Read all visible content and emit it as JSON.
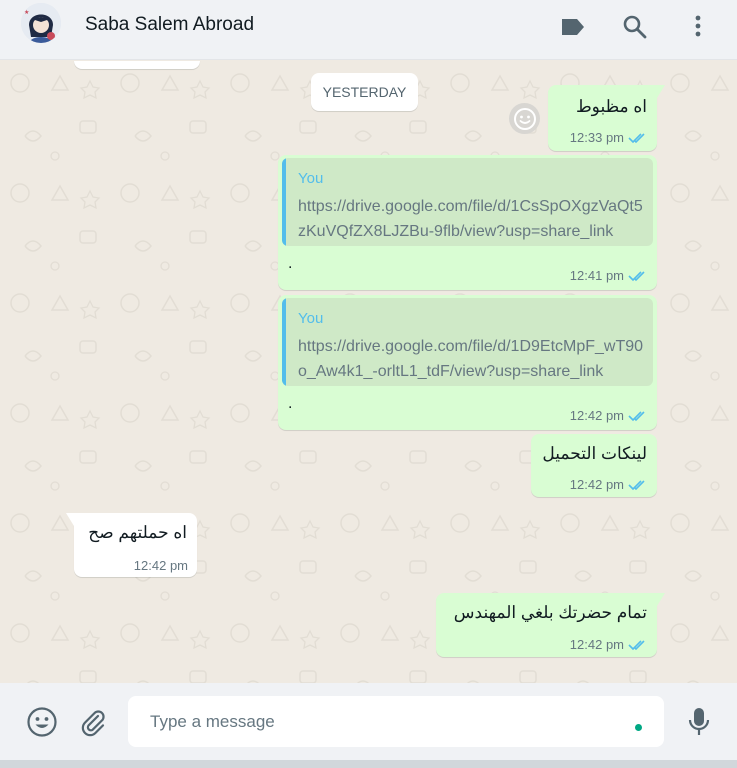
{
  "header": {
    "contact_name": "Saba Salem Abroad",
    "icons": [
      "label-icon",
      "search-icon",
      "menu-icon"
    ]
  },
  "chat": {
    "date_chip": "YESTERDAY",
    "messages": [
      {
        "direction": "out",
        "text": "اه مظبوط",
        "time": "12:33 pm",
        "status": "read"
      },
      {
        "direction": "out",
        "quote_author": "You",
        "quote_text": "https://drive.google.com/file/d/1CsSpOXgzVaQt5zKuVQfZX8LJZBu-9flb/view?usp=share_link",
        "text": ".",
        "time": "12:41 pm",
        "status": "read"
      },
      {
        "direction": "out",
        "quote_author": "You",
        "quote_text": "https://drive.google.com/file/d/1D9EtcMpF_wT90o_Aw4k1_-orltL1_tdF/view?usp=share_link",
        "text": ".",
        "time": "12:42 pm",
        "status": "read"
      },
      {
        "direction": "out",
        "text": "لينكات التحميل",
        "time": "12:42 pm",
        "status": "read"
      },
      {
        "direction": "in",
        "text": "اه حملتهم صح",
        "time": "12:42 pm"
      },
      {
        "direction": "out",
        "text": "تمام حضرتك بلغي المهندس",
        "time": "12:42 pm",
        "status": "read"
      }
    ]
  },
  "footer": {
    "placeholder": "Type a message",
    "icons": [
      "emoji-icon",
      "attach-icon",
      "mic-icon"
    ]
  },
  "colors": {
    "outgoing_bubble": "#d9fdd3",
    "incoming_bubble": "#ffffff",
    "read_ticks": "#53bdeb",
    "accent": "#00a884"
  }
}
